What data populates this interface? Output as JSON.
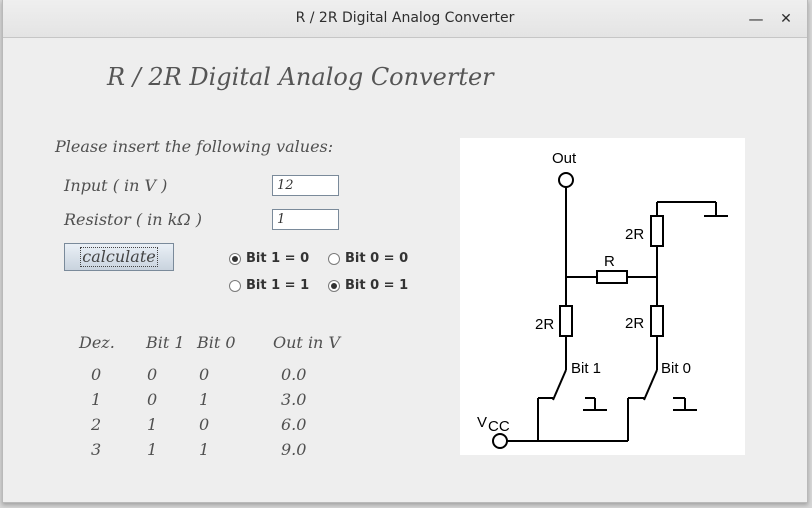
{
  "window": {
    "title": "R / 2R Digital Analog Converter",
    "minimize_glyph": "—",
    "close_glyph": "✕"
  },
  "app": {
    "heading": "R / 2R Digital Analog Converter",
    "instruction": "Please insert the following values:"
  },
  "form": {
    "input_label": "Input ( in V )",
    "input_value": "12",
    "resistor_label": "Resistor ( in kΩ )",
    "resistor_value": "1",
    "calculate_label": "calculate"
  },
  "radios": {
    "bit1_0": {
      "label": "Bit 1 = 0",
      "selected": true
    },
    "bit1_1": {
      "label": "Bit 1 = 1",
      "selected": false
    },
    "bit0_0": {
      "label": "Bit 0 = 0",
      "selected": false
    },
    "bit0_1": {
      "label": "Bit 0 = 1",
      "selected": true
    }
  },
  "table": {
    "headers": [
      "Dez.",
      "Bit 1",
      "Bit 0",
      "Out in V"
    ],
    "rows": [
      [
        "0",
        "0",
        "0",
        "0.0"
      ],
      [
        "1",
        "0",
        "1",
        "3.0"
      ],
      [
        "2",
        "1",
        "0",
        "6.0"
      ],
      [
        "3",
        "1",
        "1",
        "9.0"
      ]
    ]
  },
  "circuit": {
    "out_label": "Out",
    "r_label": "R",
    "two_r_top": "2R",
    "two_r_left": "2R",
    "two_r_right": "2R",
    "bit1_label": "Bit 1",
    "bit0_label": "Bit 0",
    "vcc_label": "V",
    "vcc_sub": "CC"
  }
}
